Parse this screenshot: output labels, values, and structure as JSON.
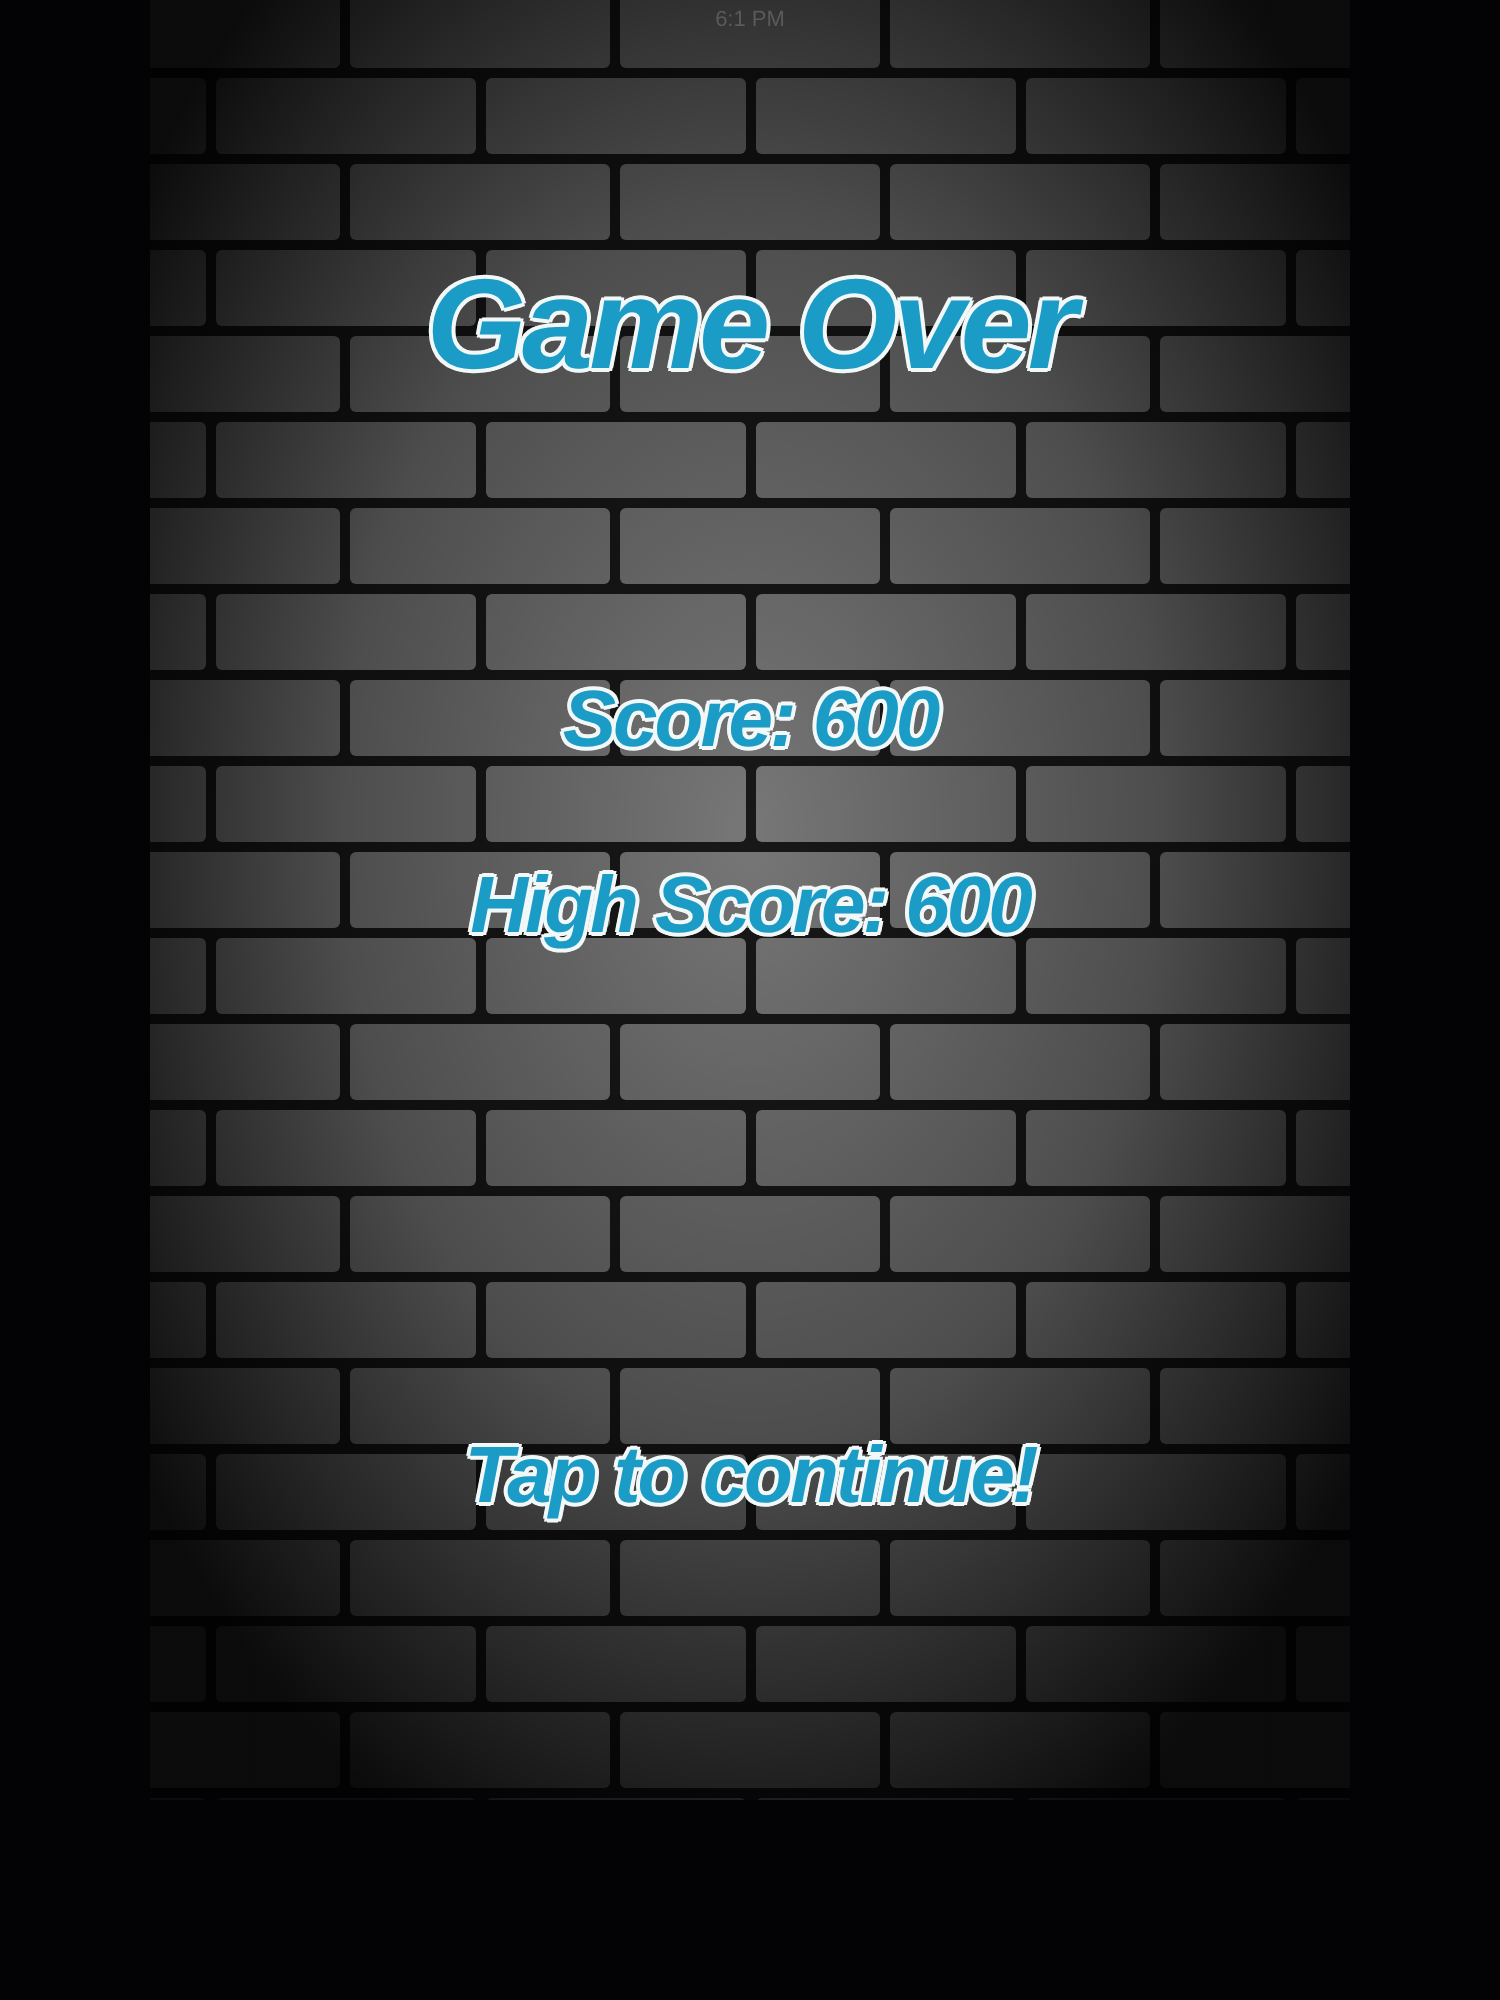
{
  "status_bar": {
    "time": "6:1 PM"
  },
  "title": "Game Over",
  "scores": [
    {
      "text": "Score: 600"
    },
    {
      "text": "High Score: 600"
    }
  ],
  "prompt": "Tap to continue!"
}
